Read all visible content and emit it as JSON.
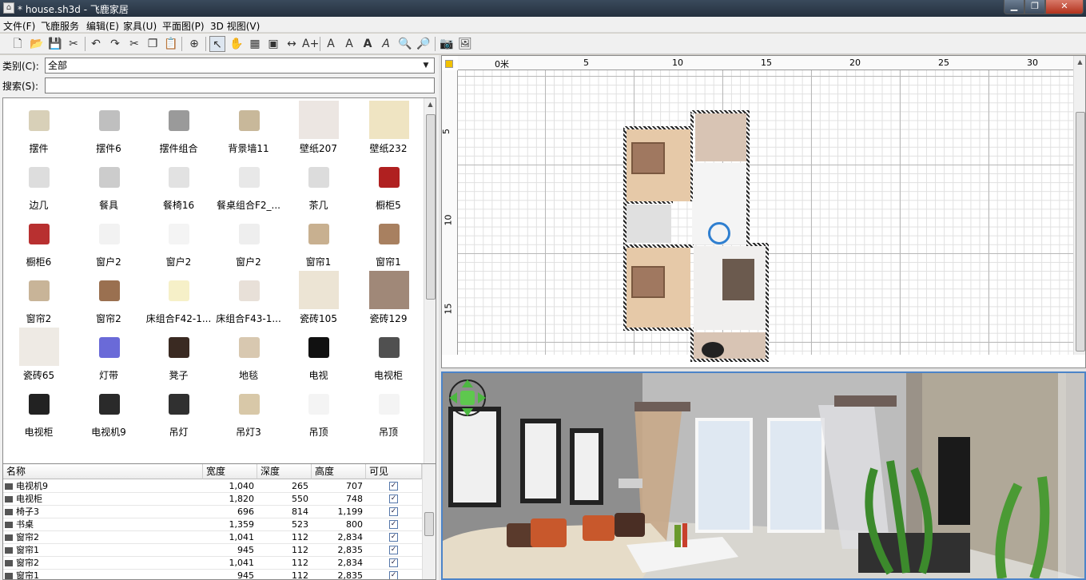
{
  "window": {
    "title": "* house.sh3d - 飞鹿家居"
  },
  "menu": [
    "文件(F)",
    "飞鹿服务",
    "编辑(E)",
    "家具(U)",
    "平面图(P)",
    "3D 视图(V)"
  ],
  "toolbar": [
    "new-file-icon",
    "open-icon",
    "save-icon",
    "cut-icon",
    "undo-icon",
    "redo-icon",
    "scissors-icon",
    "copy-icon",
    "paste-icon",
    "add-furniture-icon",
    "select-arrow-icon",
    "pan-hand-icon",
    "create-walls-icon",
    "create-rooms-icon",
    "create-dimensions-icon",
    "add-text-icon",
    "text-style-icon",
    "text-size-icon",
    "text-bold-icon",
    "text-italic-icon",
    "zoom-in-icon",
    "zoom-out-icon",
    "camera-icon",
    "photo-icon"
  ],
  "catalog": {
    "category_label": "类别(C):",
    "category_value": "全部",
    "search_label": "搜索(S):",
    "search_value": "",
    "items": [
      "摆件",
      "摆件6",
      "摆件组合",
      "背景墙11",
      "壁纸207",
      "壁纸232",
      "边几",
      "餐具",
      "餐椅16",
      "餐桌组合F2_...",
      "茶几",
      "橱柜5",
      "橱柜6",
      "窗户2",
      "窗户2",
      "窗户2",
      "窗帘1",
      "窗帘1",
      "窗帘2",
      "窗帘2",
      "床组合F42-1...",
      "床组合F43-1...",
      "瓷砖105",
      "瓷砖129",
      "瓷砖65",
      "灯带",
      "凳子",
      "地毯",
      "电视",
      "电视柜",
      "电视柜",
      "电视机9",
      "吊灯",
      "吊灯3",
      "吊顶",
      "吊顶"
    ]
  },
  "table": {
    "headers": [
      "名称",
      "宽度",
      "深度",
      "高度",
      "可见"
    ],
    "rows": [
      {
        "name": "电视机9",
        "width": "1,040",
        "depth": "265",
        "height": "707",
        "visible": "✓"
      },
      {
        "name": "电视柜",
        "width": "1,820",
        "depth": "550",
        "height": "748",
        "visible": "✓"
      },
      {
        "name": "椅子3",
        "width": "696",
        "depth": "814",
        "height": "1,199",
        "visible": "✓"
      },
      {
        "name": "书桌",
        "width": "1,359",
        "depth": "523",
        "height": "800",
        "visible": "✓"
      },
      {
        "name": "窗帘2",
        "width": "1,041",
        "depth": "112",
        "height": "2,834",
        "visible": "✓"
      },
      {
        "name": "窗帘1",
        "width": "945",
        "depth": "112",
        "height": "2,835",
        "visible": "✓"
      },
      {
        "name": "窗帘2",
        "width": "1,041",
        "depth": "112",
        "height": "2,834",
        "visible": "✓"
      },
      {
        "name": "窗帘1",
        "width": "945",
        "depth": "112",
        "height": "2,835",
        "visible": "✓"
      }
    ]
  },
  "plan": {
    "ruler_x": [
      "0米",
      "5",
      "10",
      "15",
      "20",
      "25",
      "30"
    ],
    "ruler_y": [
      "5",
      "10",
      "15"
    ]
  },
  "colors": {
    "accent": "#4c84c8",
    "floor_wood": "#e6c9a8",
    "floor_tile": "#d8c4b4"
  }
}
